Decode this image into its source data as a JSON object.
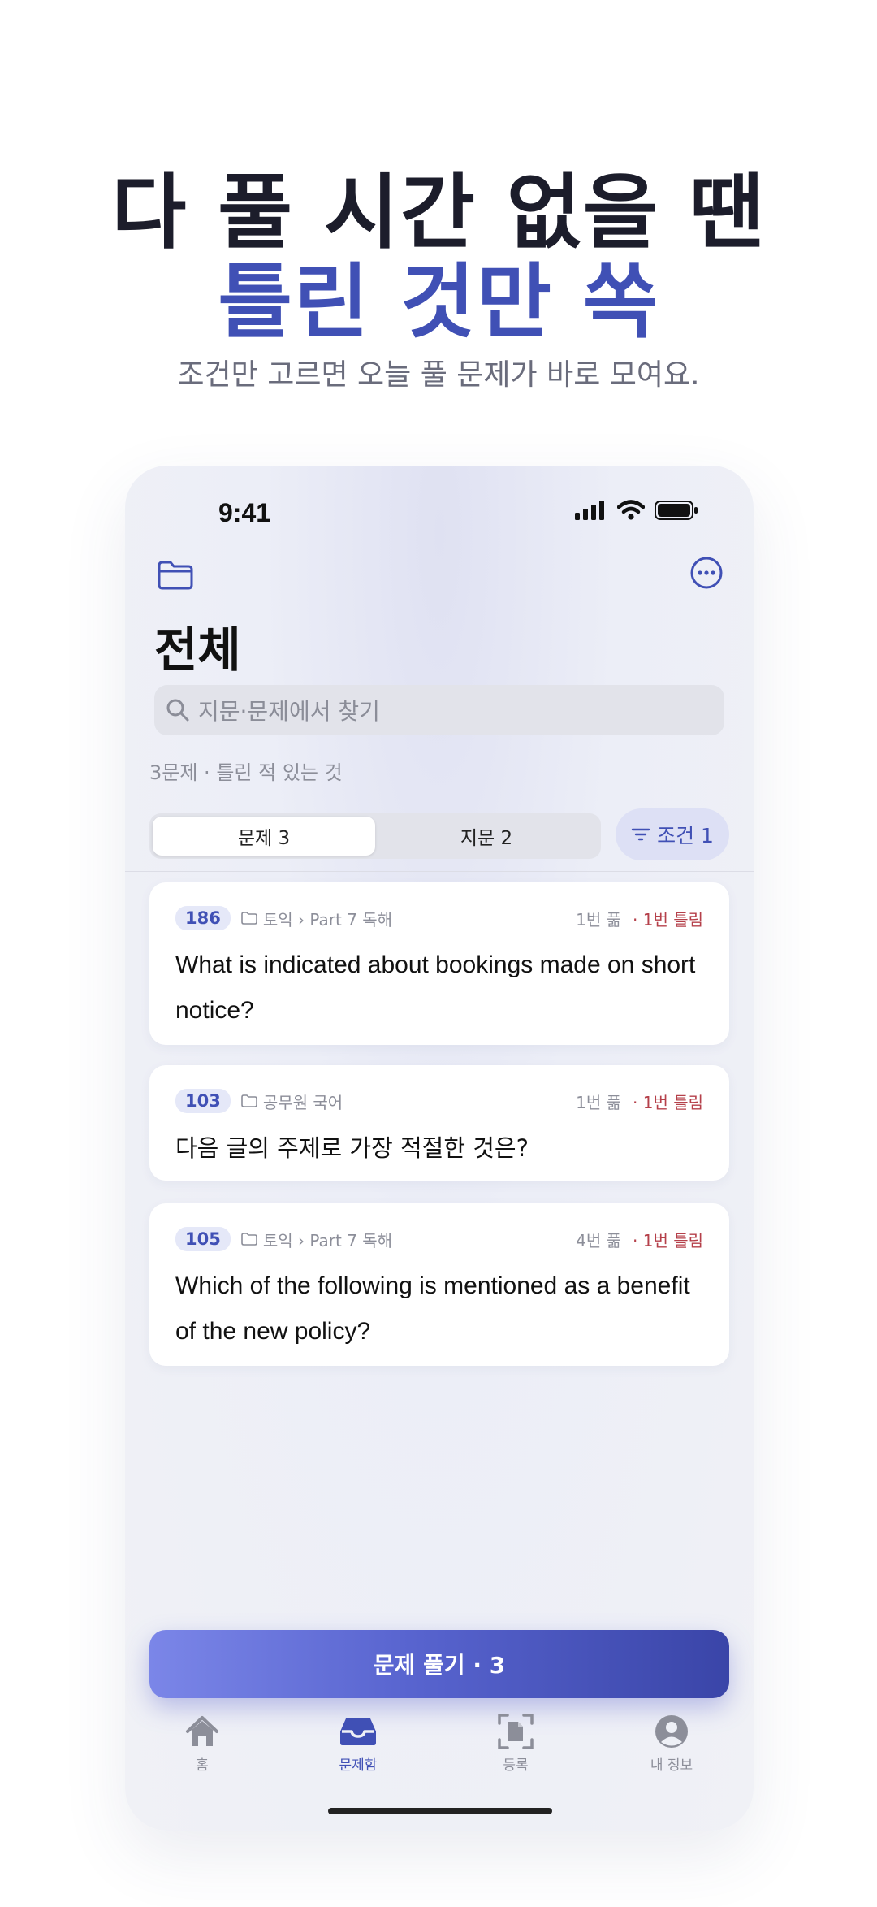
{
  "promo": {
    "headline_line1": "다 풀 시간 없을 땐",
    "headline_line2": "틀린 것만 쏙",
    "subtitle": "조건만 고르면 오늘 풀 문제가 바로 모여요."
  },
  "status_bar": {
    "time": "9:41"
  },
  "header": {
    "title": "전체",
    "folder_icon": "folder-icon",
    "more_icon": "more-icon"
  },
  "search": {
    "placeholder": "지문·문제에서 찾기"
  },
  "summary": "3문제 · 틀린 적 있는 것",
  "segment": {
    "items": [
      {
        "label": "문제 3",
        "active": true
      },
      {
        "label": "지문 2",
        "active": false
      }
    ]
  },
  "filter": {
    "label": "조건 1"
  },
  "cards": [
    {
      "number": "186",
      "path": "토익 › Part 7 독해",
      "solved": "1번 풂",
      "wrong": "· 1번 틀림",
      "text": "What is indicated about bookings made on short notice?"
    },
    {
      "number": "103",
      "path": "공무원 국어",
      "solved": "1번 풂",
      "wrong": "· 1번 틀림",
      "text": "다음 글의 주제로 가장 적절한 것은?"
    },
    {
      "number": "105",
      "path": "토익 › Part 7 독해",
      "solved": "4번 풂",
      "wrong": "· 1번 틀림",
      "text": "Which of the following is mentioned as a benefit of the new policy?"
    }
  ],
  "cta": {
    "label": "문제 풀기 · 3"
  },
  "tabs": [
    {
      "label": "홈",
      "icon": "home-icon",
      "active": false
    },
    {
      "label": "문제함",
      "icon": "inbox-icon",
      "active": true
    },
    {
      "label": "등록",
      "icon": "scan-icon",
      "active": false
    },
    {
      "label": "내 정보",
      "icon": "profile-icon",
      "active": false
    }
  ],
  "colors": {
    "accent": "#4050b5",
    "wrong": "#b5404a",
    "headline_dark": "#1c1d2b"
  }
}
